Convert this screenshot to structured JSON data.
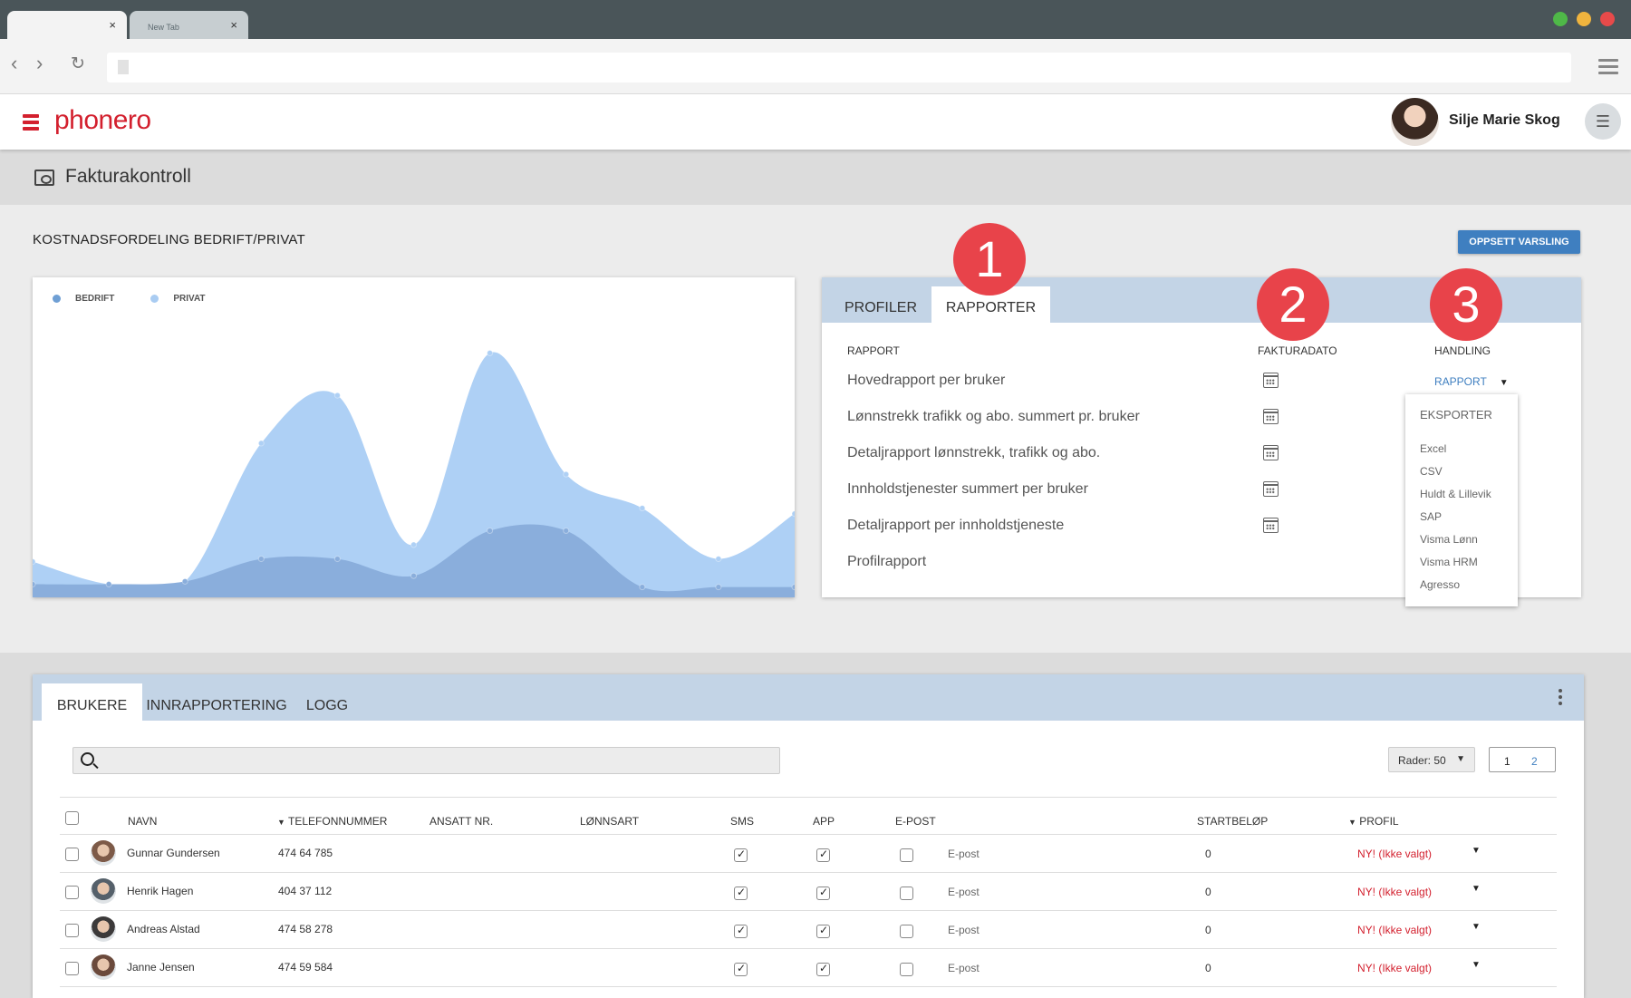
{
  "browser": {
    "tabs": [
      {
        "label": "",
        "active": true
      },
      {
        "label": "New Tab",
        "active": false
      }
    ],
    "close_glyph": "×",
    "window_dots": [
      "#4fb848",
      "#f0b43e",
      "#e74a4a"
    ]
  },
  "app": {
    "logo": "phonero",
    "brand_color": "#d3202e",
    "user_name": "Silje Marie Skog",
    "page_title": "Fakturakontroll"
  },
  "cost_section": {
    "title": "KOSTNADSFORDELING BEDRIFT/PRIVAT",
    "alert_button": "OPPSETT VARSLING",
    "legend": [
      {
        "label": "BEDRIFT",
        "color": "#6f9fd4"
      },
      {
        "label": "PRIVAT",
        "color": "#a9ccf2"
      }
    ]
  },
  "chart_data": {
    "type": "area",
    "x": [
      0,
      1,
      2,
      3,
      4,
      5,
      6,
      7,
      8,
      9,
      10
    ],
    "ylim": [
      0,
      100
    ],
    "grid": false,
    "legend_position": "top-left",
    "series": [
      {
        "name": "BEDRIFT",
        "color": "#8aaedc",
        "values": [
          4,
          4,
          5,
          13,
          13,
          7,
          23,
          23,
          3,
          3,
          3
        ]
      },
      {
        "name": "PRIVAT",
        "color": "#aed0f5",
        "values": [
          12,
          4,
          5,
          54,
          71,
          18,
          86,
          43,
          31,
          13,
          29
        ]
      }
    ]
  },
  "reports": {
    "tabs": [
      "PROFILER",
      "RAPPORTER"
    ],
    "columns": {
      "report": "RAPPORT",
      "date": "FAKTURADATO",
      "action": "HANDLING"
    },
    "rows": [
      "Hovedrapport per bruker",
      "Lønnstrekk trafikk og abo. summert pr. bruker",
      "Detaljrapport lønnstrekk, trafikk og abo.",
      "Innholdstjenester summert per bruker",
      "Detaljrapport per innholdstjeneste",
      "Profilrapport"
    ],
    "action_label": "RAPPORT",
    "dropdown": {
      "header": "EKSPORTER",
      "options": [
        "Excel",
        "CSV",
        "Huldt & Lillevik",
        "SAP",
        "Visma Lønn",
        "Visma HRM",
        "Agresso"
      ]
    }
  },
  "badges": [
    "1",
    "2",
    "3"
  ],
  "users": {
    "tabs": [
      "BRUKERE",
      "INNRAPPORTERING",
      "LOGG"
    ],
    "search_placeholder": "",
    "rows_label": "Rader: 50",
    "pages": [
      "1",
      "2"
    ],
    "columns": [
      "NAVN",
      "TELEFONNUMMER",
      "ANSATT NR.",
      "LØNNSART",
      "SMS",
      "APP",
      "E-POST",
      "STARTBELØP",
      "PROFIL"
    ],
    "filter_glyph": "▼",
    "rows": [
      {
        "name": "Gunnar Gundersen",
        "phone": "474 64 785",
        "sms": true,
        "app": true,
        "epost": false,
        "epost_label": "E-post",
        "start": "0",
        "profile": "NY! (Ikke valgt)",
        "avatar_color": "#7d5a48"
      },
      {
        "name": "Henrik Hagen",
        "phone": "404 37 112",
        "sms": true,
        "app": true,
        "epost": false,
        "epost_label": "E-post",
        "start": "0",
        "profile": "NY! (Ikke valgt)",
        "avatar_color": "#55606a"
      },
      {
        "name": "Andreas Alstad",
        "phone": "474 58 278",
        "sms": true,
        "app": true,
        "epost": false,
        "epost_label": "E-post",
        "start": "0",
        "profile": "NY! (Ikke valgt)",
        "avatar_color": "#3c3a3a"
      },
      {
        "name": "Janne Jensen",
        "phone": "474 59 584",
        "sms": true,
        "app": true,
        "epost": false,
        "epost_label": "E-post",
        "start": "0",
        "profile": "NY! (Ikke valgt)",
        "avatar_color": "#6b4a3c"
      }
    ]
  }
}
